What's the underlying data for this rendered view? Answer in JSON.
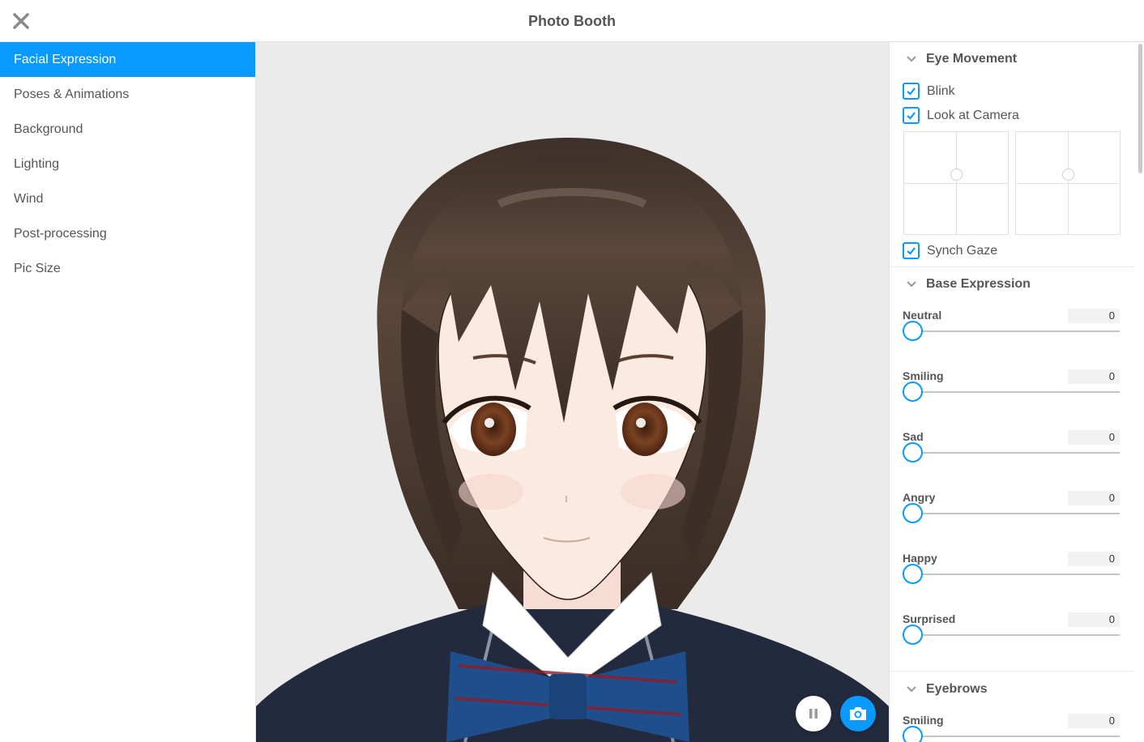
{
  "window": {
    "title": "Photo Booth"
  },
  "sidebar": {
    "items": [
      {
        "label": "Facial Expression",
        "active": true
      },
      {
        "label": "Poses & Animations",
        "active": false
      },
      {
        "label": "Background",
        "active": false
      },
      {
        "label": "Lighting",
        "active": false
      },
      {
        "label": "Wind",
        "active": false
      },
      {
        "label": "Post-processing",
        "active": false
      },
      {
        "label": "Pic Size",
        "active": false
      }
    ]
  },
  "panel": {
    "eye_movement": {
      "title": "Eye Movement",
      "blink": {
        "label": "Blink",
        "checked": true
      },
      "look_at_camera": {
        "label": "Look at Camera",
        "checked": true
      },
      "synch_gaze": {
        "label": "Synch Gaze",
        "checked": true
      }
    },
    "base_expression": {
      "title": "Base Expression",
      "sliders": [
        {
          "label": "Neutral",
          "value": "0"
        },
        {
          "label": "Smiling",
          "value": "0"
        },
        {
          "label": "Sad",
          "value": "0"
        },
        {
          "label": "Angry",
          "value": "0"
        },
        {
          "label": "Happy",
          "value": "0"
        },
        {
          "label": "Surprised",
          "value": "0"
        }
      ]
    },
    "eyebrows": {
      "title": "Eyebrows",
      "sliders": [
        {
          "label": "Smiling",
          "value": "0"
        }
      ]
    }
  },
  "colors": {
    "accent": "#0a99ff"
  }
}
